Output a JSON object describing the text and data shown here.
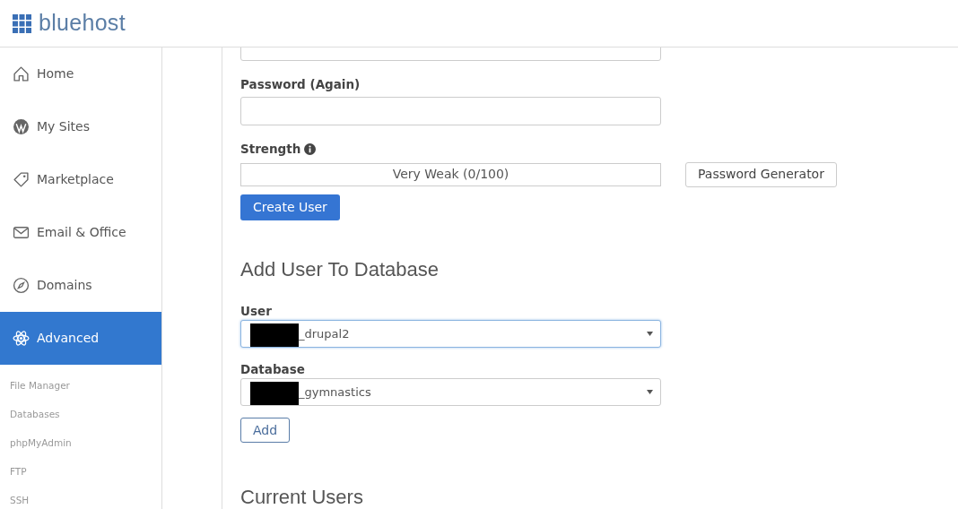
{
  "logo": {
    "text": "bluehost"
  },
  "sidebar": {
    "items": [
      {
        "label": "Home",
        "selected": false
      },
      {
        "label": "My Sites",
        "selected": false
      },
      {
        "label": "Marketplace",
        "selected": false
      },
      {
        "label": "Email & Office",
        "selected": false
      },
      {
        "label": "Domains",
        "selected": false
      },
      {
        "label": "Advanced",
        "selected": true
      }
    ],
    "subitems": [
      "File Manager",
      "Databases",
      "phpMyAdmin",
      "FTP",
      "SSH"
    ]
  },
  "create_user": {
    "password_again_label": "Password (Again)",
    "strength_label": "Strength",
    "strength": {
      "text": "Very Weak (0/100)"
    },
    "generator_button": "Password Generator",
    "create_button": "Create User"
  },
  "add_user": {
    "title": "Add User To Database",
    "user_label": "User",
    "user_value": "_drupal2",
    "database_label": "Database",
    "database_value": "_gymnastics",
    "add_button": "Add"
  },
  "current_users": {
    "title": "Current Users"
  }
}
